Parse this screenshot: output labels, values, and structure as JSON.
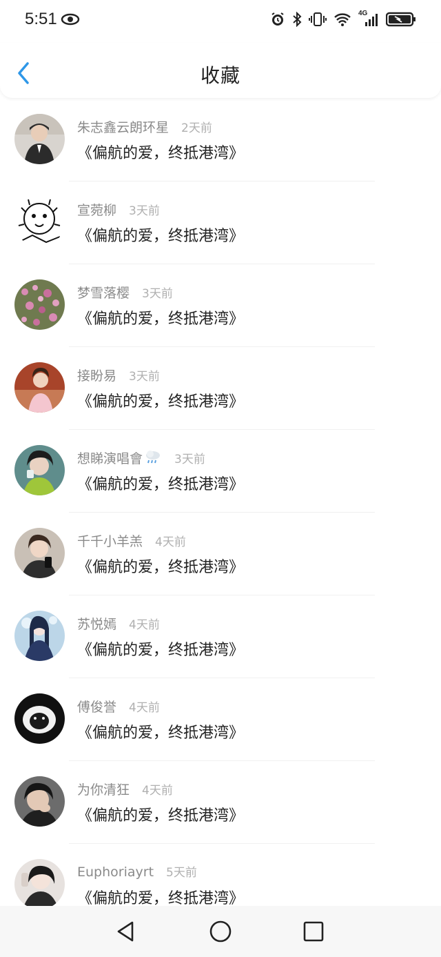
{
  "status_bar": {
    "time": "5:51",
    "network": "4G",
    "icons": [
      "eye-icon",
      "alarm-icon",
      "bluetooth-icon",
      "vibrate-icon",
      "wifi-icon",
      "signal-icon",
      "battery-icon"
    ]
  },
  "header": {
    "title": "收藏",
    "back_icon": "chevron-left-icon",
    "accent_color": "#2e97e8"
  },
  "items": [
    {
      "name": "朱志鑫云朗环星",
      "time": "2天前",
      "book": "《偏航的爱，终抵港湾》",
      "avatar": "avatar-1"
    },
    {
      "name": "宣菀柳",
      "time": "3天前",
      "book": "《偏航的爱，终抵港湾》",
      "avatar": "avatar-2"
    },
    {
      "name": "梦雪落樱",
      "time": "3天前",
      "book": "《偏航的爱，终抵港湾》",
      "avatar": "avatar-3"
    },
    {
      "name": "接盼易",
      "time": "3天前",
      "book": "《偏航的爱，终抵港湾》",
      "avatar": "avatar-4"
    },
    {
      "name": "想睇演唱會",
      "time": "3天前",
      "book": "《偏航的爱，终抵港湾》",
      "avatar": "avatar-5",
      "emoji": "cloud-rain-icon"
    },
    {
      "name": "千千小羊羔",
      "time": "4天前",
      "book": "《偏航的爱，终抵港湾》",
      "avatar": "avatar-6"
    },
    {
      "name": "苏悦嫣",
      "time": "4天前",
      "book": "《偏航的爱，终抵港湾》",
      "avatar": "avatar-7"
    },
    {
      "name": "傅俊誉",
      "time": "4天前",
      "book": "《偏航的爱，终抵港湾》",
      "avatar": "avatar-8"
    },
    {
      "name": "为你清狂",
      "time": "4天前",
      "book": "《偏航的爱，终抵港湾》",
      "avatar": "avatar-9"
    },
    {
      "name": "Euphoriayrt",
      "time": "5天前",
      "book": "《偏航的爱，终抵港湾》",
      "avatar": "avatar-10"
    }
  ],
  "nav_bar": {
    "buttons": [
      "back-triangle-icon",
      "home-circle-icon",
      "recents-square-icon"
    ]
  }
}
